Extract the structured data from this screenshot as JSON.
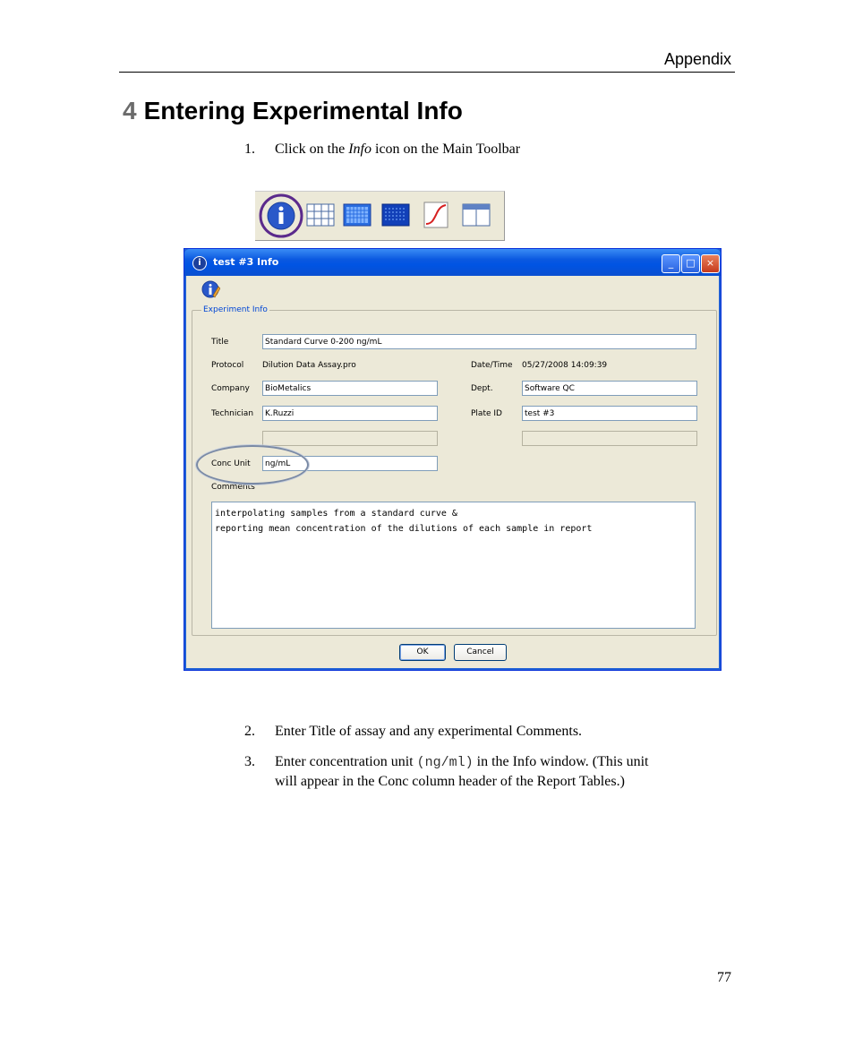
{
  "header": {
    "section": "Appendix"
  },
  "section": {
    "number": "4",
    "title": "Entering Experimental Info"
  },
  "steps": {
    "s1": {
      "num": "1.",
      "pre": "Click on the ",
      "em": "Info",
      "post": " icon on the Main Toolbar"
    },
    "s2": {
      "num": "2.",
      "text": "Enter Title of assay and any experimental Comments."
    },
    "s3": {
      "num": "3.",
      "pre": "Enter concentration unit ",
      "code": "(ng/ml)",
      "post": " in the Info window. (This unit",
      "line2": "will appear in the Conc column header of the Report Tables.)"
    }
  },
  "toolbar": {
    "icons": [
      "info-icon",
      "grid-icon",
      "plate-light-icon",
      "plate-dark-icon",
      "curve-icon",
      "table-icon"
    ],
    "highlight_color": "#5b2a8c"
  },
  "dialog": {
    "title": "test #3 Info",
    "group_label": "Experiment Info",
    "fields": {
      "title": {
        "label": "Title",
        "value": "Standard Curve 0-200 ng/mL"
      },
      "protocol": {
        "label": "Protocol",
        "value": "Dilution Data Assay.pro"
      },
      "datetime": {
        "label": "Date/Time",
        "value": "05/27/2008 14:09:39"
      },
      "company": {
        "label": "Company",
        "value": "BioMetalics"
      },
      "dept": {
        "label": "Dept.",
        "value": "Software QC"
      },
      "technician": {
        "label": "Technician",
        "value": "K.Ruzzi"
      },
      "plate_id": {
        "label": "Plate ID",
        "value": "test #3"
      },
      "conc_unit": {
        "label": "Conc Unit",
        "value": "ng/mL"
      },
      "comments": {
        "label": "Comments",
        "line1": "interpolating samples from a standard curve &",
        "line2": "reporting mean concentration of the dilutions of each sample in report"
      }
    },
    "buttons": {
      "ok": "OK",
      "cancel": "Cancel"
    }
  },
  "footer": {
    "page": "77"
  }
}
